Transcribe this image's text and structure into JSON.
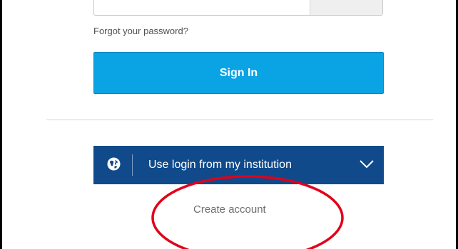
{
  "login": {
    "forgot_password": "Forgot your password?",
    "sign_in_label": "Sign In",
    "institution_label": "Use login from my institution",
    "create_account": "Create account"
  },
  "icons": {
    "globe": "globe-icon",
    "chevron": "chevron-down-icon"
  },
  "colors": {
    "sign_in_button": "#0aa3e4",
    "institution_button": "#104a8b",
    "annotation_circle": "#e2001a"
  }
}
